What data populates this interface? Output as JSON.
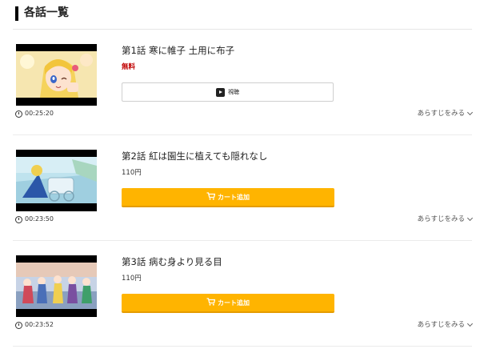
{
  "section": {
    "title": "各話一覧"
  },
  "episodes": [
    {
      "title": "第1話 寒に帷子 土用に布子",
      "price": "無料",
      "button_label": "視聴",
      "button_icon": "play-icon",
      "duration": "00:25:20",
      "synopsis_label": "あらすじをみる"
    },
    {
      "title": "第2話 紅は園生に植えても隠れなし",
      "price": "110円",
      "button_label": "カート追加",
      "button_icon": "cart-icon",
      "duration": "00:23:50",
      "synopsis_label": "あらすじをみる"
    },
    {
      "title": "第3話 病む身より見る目",
      "price": "110円",
      "button_label": "カート追加",
      "button_icon": "cart-icon",
      "duration": "00:23:52",
      "synopsis_label": "あらすじをみる"
    }
  ],
  "colors": {
    "cart_button": "#ffb400",
    "free_price": "#c00000",
    "section_bar": "#000000"
  }
}
